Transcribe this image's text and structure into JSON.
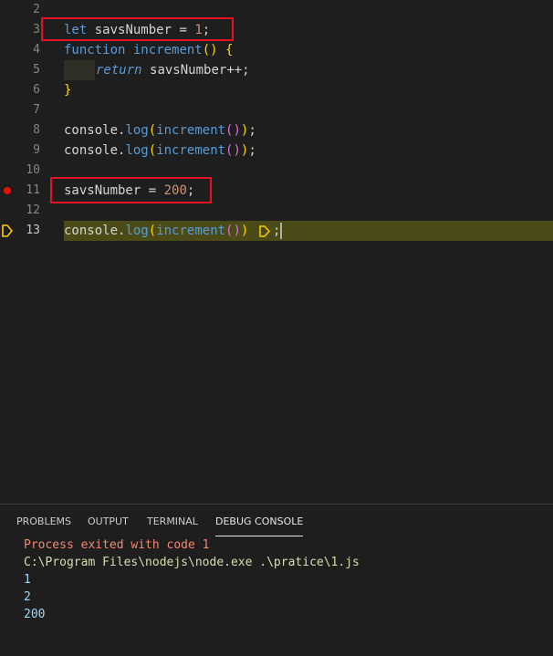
{
  "editor": {
    "lines": [
      {
        "n": "2"
      },
      {
        "n": "3"
      },
      {
        "n": "4"
      },
      {
        "n": "5"
      },
      {
        "n": "6"
      },
      {
        "n": "7"
      },
      {
        "n": "8"
      },
      {
        "n": "9"
      },
      {
        "n": "10"
      },
      {
        "n": "11"
      },
      {
        "n": "12"
      },
      {
        "n": "13"
      }
    ],
    "tokens": {
      "let": "let",
      "savsNumber": "savsNumber",
      "eq": " = ",
      "one": "1",
      "semi": ";",
      "function": "function",
      "increment": "increment",
      "parens": "()",
      "brace_open": " {",
      "return": "return",
      "plusplus": "++;",
      "brace_close": "}",
      "console": "console",
      "dot": ".",
      "log": "log",
      "lp": "(",
      "rp": ")",
      "two_hundred": "200"
    }
  },
  "panel": {
    "tabs": [
      "PROBLEMS",
      "OUTPUT",
      "TERMINAL",
      "DEBUG CONSOLE"
    ],
    "active_tab": "DEBUG CONSOLE",
    "output": [
      {
        "text": "Process exited with code 1",
        "color": "#f48771"
      },
      {
        "text": "C:\\Program Files\\nodejs\\node.exe .\\pratice\\1.js",
        "color": "#dcdcaa"
      },
      {
        "text": "1",
        "color": "#9cdcfe"
      },
      {
        "text": "2",
        "color": "#9cdcfe"
      },
      {
        "text": "200",
        "color": "#9cdcfe"
      }
    ]
  },
  "colors": {
    "highlight_box": "#e81123",
    "breakpoint": "#e51400",
    "debug_line_bg": "#4b4b18"
  }
}
